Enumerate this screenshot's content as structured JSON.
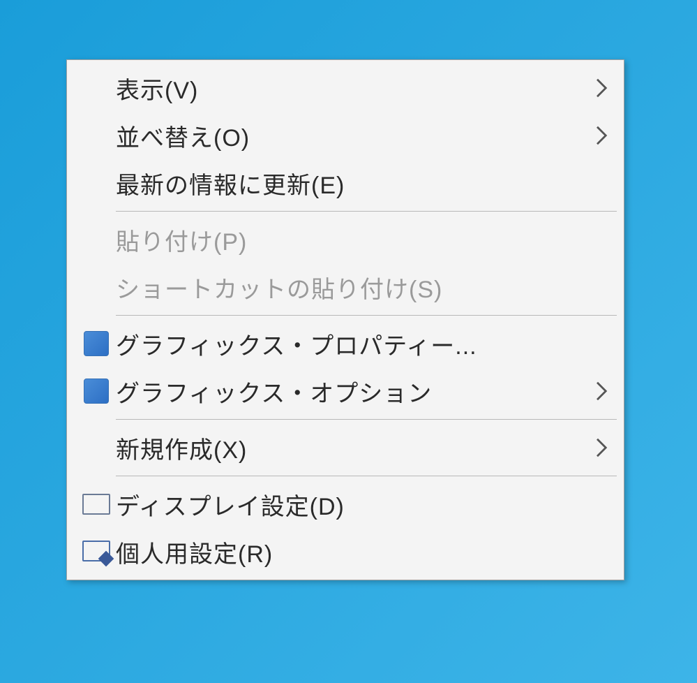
{
  "menu": {
    "items": [
      {
        "label": "表示(V)",
        "has_submenu": true,
        "disabled": false,
        "icon": null
      },
      {
        "label": "並べ替え(O)",
        "has_submenu": true,
        "disabled": false,
        "icon": null
      },
      {
        "label": "最新の情報に更新(E)",
        "has_submenu": false,
        "disabled": false,
        "icon": null
      },
      {
        "separator": true
      },
      {
        "label": "貼り付け(P)",
        "has_submenu": false,
        "disabled": true,
        "icon": null
      },
      {
        "label": "ショートカットの貼り付け(S)",
        "has_submenu": false,
        "disabled": true,
        "icon": null
      },
      {
        "separator": true
      },
      {
        "label": "グラフィックス・プロパティー...",
        "has_submenu": false,
        "disabled": false,
        "icon": "intel-blue"
      },
      {
        "label": "グラフィックス・オプション",
        "has_submenu": true,
        "disabled": false,
        "icon": "intel-blue"
      },
      {
        "separator": true
      },
      {
        "label": "新規作成(X)",
        "has_submenu": true,
        "disabled": false,
        "icon": null
      },
      {
        "separator": true
      },
      {
        "label": "ディスプレイ設定(D)",
        "has_submenu": false,
        "disabled": false,
        "icon": "display"
      },
      {
        "label": "個人用設定(R)",
        "has_submenu": false,
        "disabled": false,
        "icon": "personalize"
      }
    ]
  }
}
